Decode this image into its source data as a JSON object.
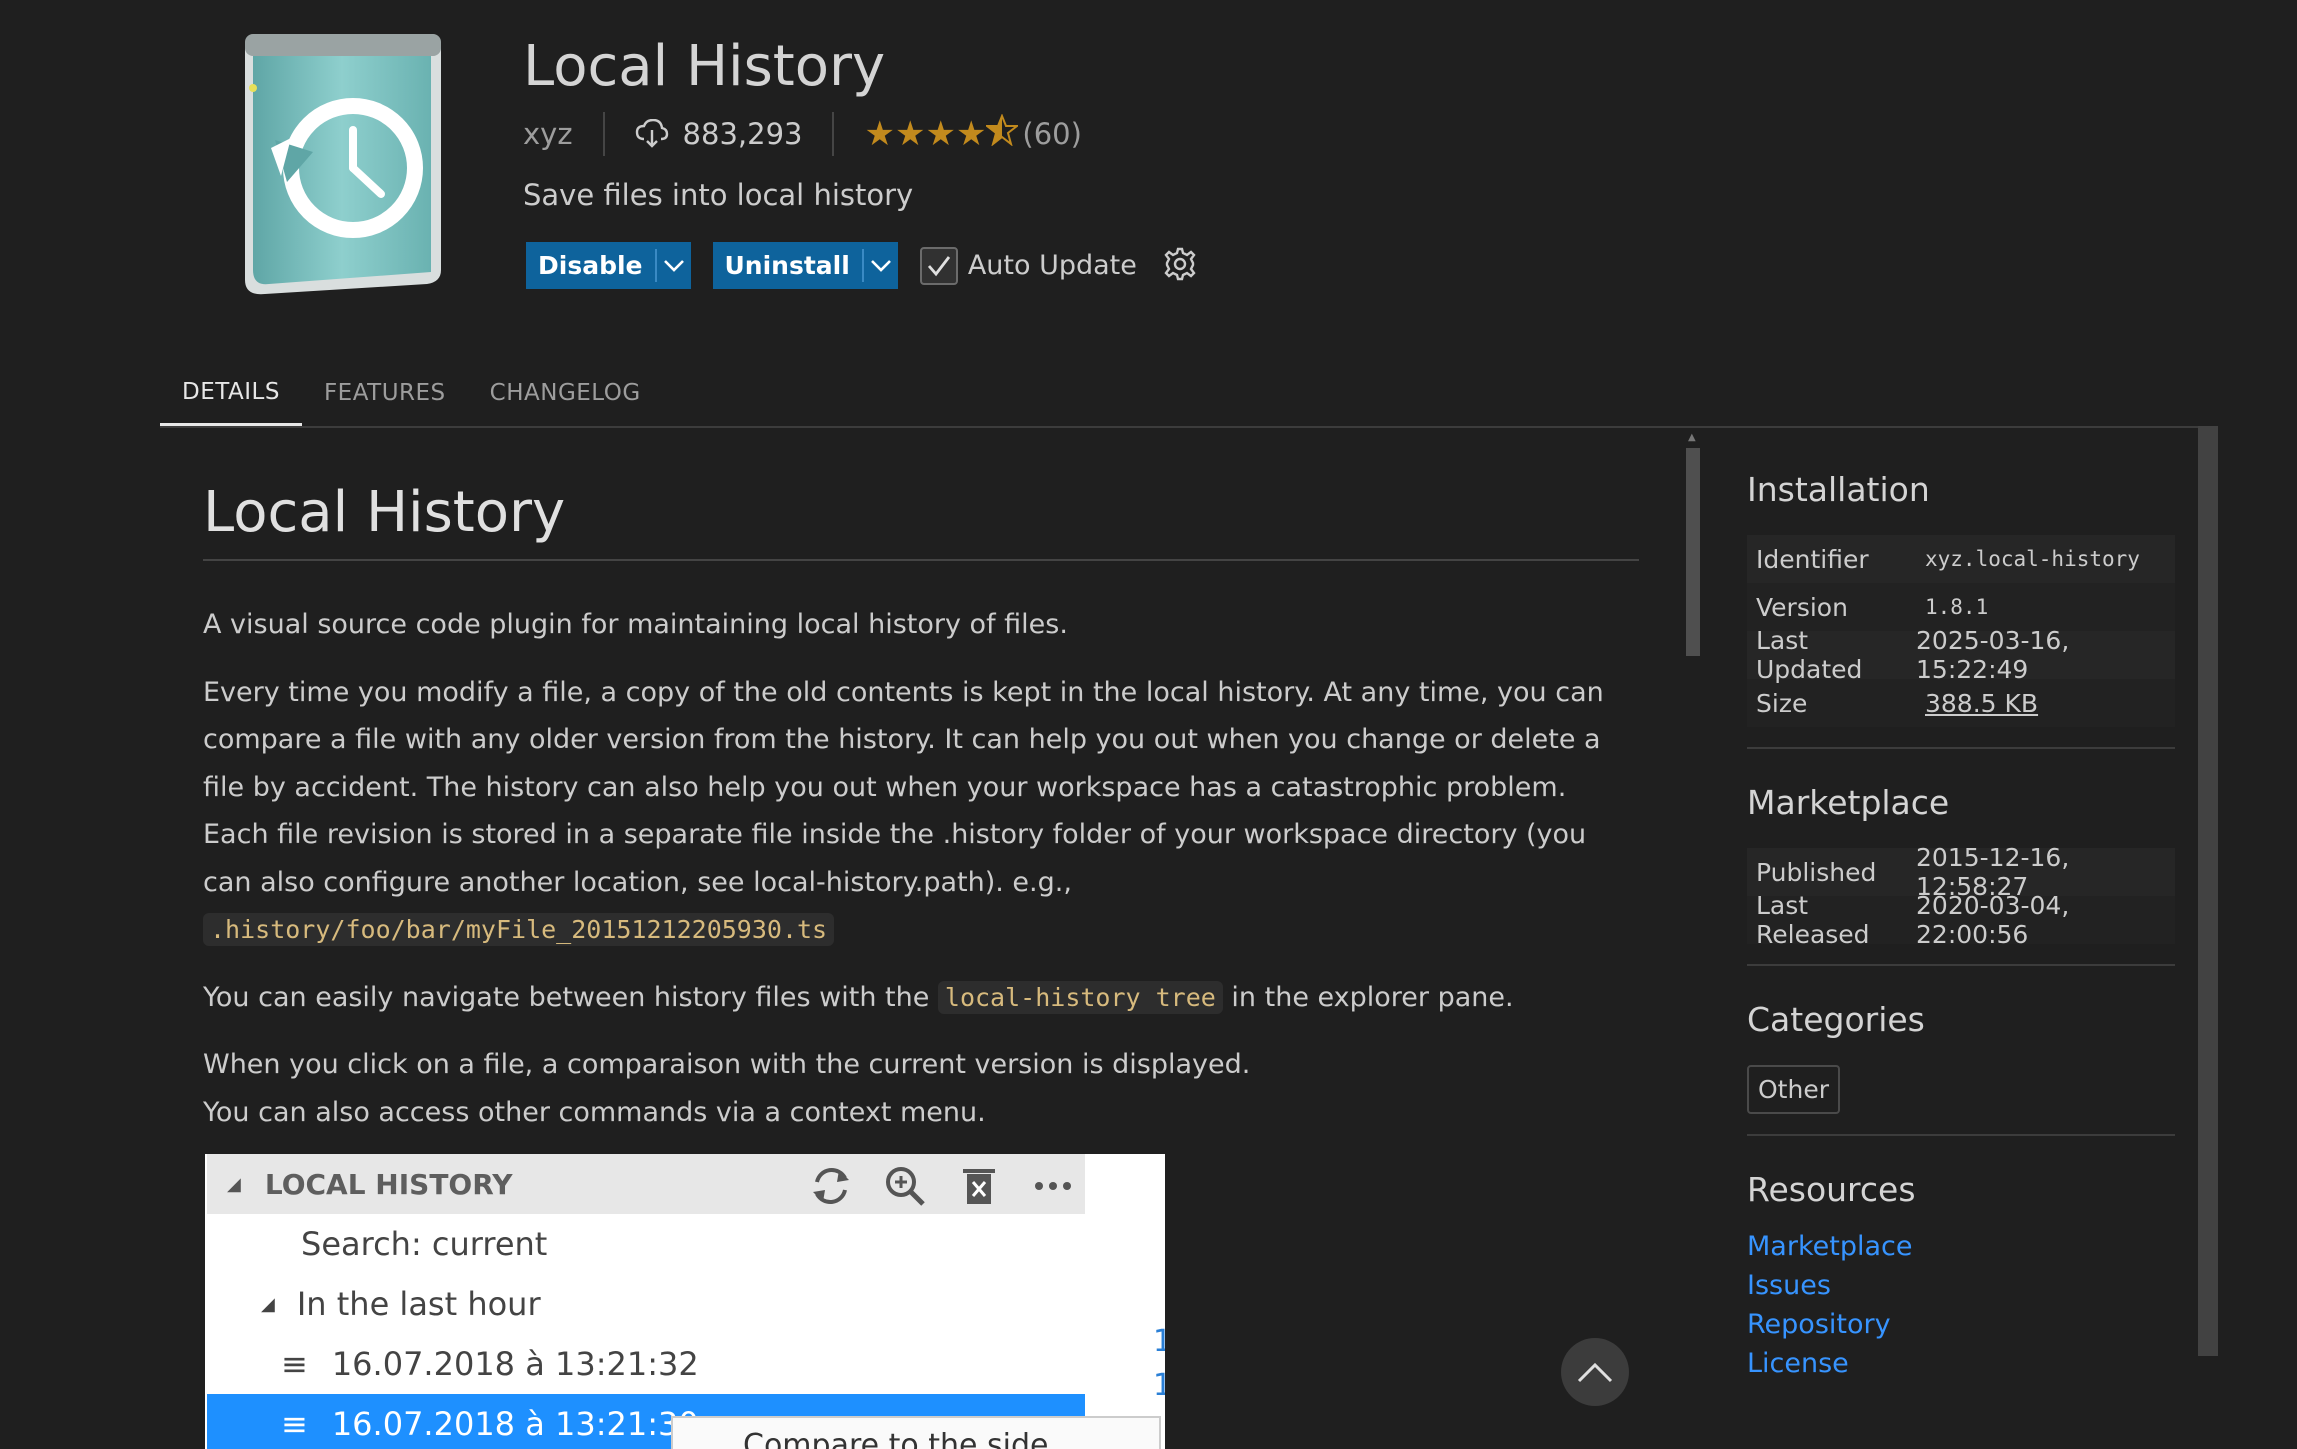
{
  "extension": {
    "name": "Local History",
    "publisher": "xyz",
    "installs": "883,293",
    "rating_stars": 4.5,
    "rating_count": "(60)",
    "description": "Save files into local history",
    "icon": "local-history-clock-book-icon"
  },
  "actions": {
    "disable_label": "Disable",
    "uninstall_label": "Uninstall",
    "auto_update_label": "Auto Update",
    "auto_update_checked": true
  },
  "tabs": [
    {
      "label": "DETAILS",
      "active": true
    },
    {
      "label": "FEATURES",
      "active": false
    },
    {
      "label": "CHANGELOG",
      "active": false
    }
  ],
  "readme": {
    "heading": "Local History",
    "p1": "A visual source code plugin for maintaining local history of files.",
    "p2_text": "Every time you modify a file, a copy of the old contents is kept in the local history. At any time, you can compare a file with any older version from the history. It can help you out when you change or delete a file by accident. The history can also help you out when your workspace has a catastrophic problem. Each file revision is stored in a separate file inside the .history folder of your workspace directory (you can also configure another location, see local-history.path). e.g., ",
    "p2_code": ".history/foo/bar/myFile_20151212205930.ts",
    "p3_before": "You can easily navigate between history files with the ",
    "p3_code": "local-history tree",
    "p3_after": " in the explorer pane.",
    "p4_line1": "When you click on a file, a comparaison with the current version is displayed.",
    "p4_line2": "You can also access other commands via a context menu.",
    "screenshot": {
      "header": "LOCAL HISTORY",
      "search_row": "Search: current",
      "group_row": "In the last hour",
      "entry1": "16.07.2018 à 13:21:32",
      "entry2": "16.07.2018 à 13:21:30",
      "menu_partial": "Compare to the side"
    }
  },
  "sidebar": {
    "installation": {
      "title": "Installation",
      "rows": [
        {
          "key": "Identifier",
          "value": "xyz.local-history"
        },
        {
          "key": "Version",
          "value": "1.8.1"
        },
        {
          "key": "Last Updated",
          "value": "2025-03-16, 15:22:49"
        },
        {
          "key": "Size",
          "value": "388.5 KB"
        }
      ]
    },
    "marketplace": {
      "title": "Marketplace",
      "rows": [
        {
          "key": "Published",
          "value": "2015-12-16, 12:58:27"
        },
        {
          "key": "Last Released",
          "value": "2020-03-04, 22:00:56"
        }
      ]
    },
    "categories": {
      "title": "Categories",
      "tags": [
        "Other"
      ]
    },
    "resources": {
      "title": "Resources",
      "links": [
        "Marketplace",
        "Issues",
        "Repository",
        "License"
      ]
    }
  },
  "colors": {
    "background": "#1f1f1f",
    "button": "#0e639c",
    "link": "#3794ff",
    "star": "#c28a1d",
    "code": "#d7ba7d"
  }
}
